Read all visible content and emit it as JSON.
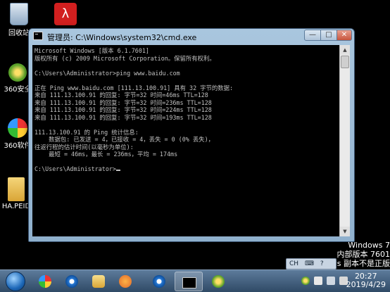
{
  "desktop": {
    "icons": [
      {
        "label": "回收站",
        "color": "#8fa9c4"
      },
      {
        "label": "",
        "color": "#d21f1f"
      },
      {
        "label": "360安全",
        "color": "#5aa12a"
      },
      {
        "label": "360软件",
        "color": "#36a84a"
      },
      {
        "label": "HA.PEID",
        "color": "#e0b040"
      }
    ]
  },
  "window": {
    "title": "管理员: C:\\Windows\\system32\\cmd.exe",
    "minimize": "—",
    "maximize": "□",
    "close": "✕"
  },
  "console": {
    "lines": [
      "Microsoft Windows [版本 6.1.7601]",
      "版权所有 (c) 2009 Microsoft Corporation。保留所有权利。",
      "",
      "C:\\Users\\Administrator>ping www.baidu.com",
      "",
      "正在 Ping www.baidu.com [111.13.100.91] 具有 32 字节的数据:",
      "来自 111.13.100.91 的回复: 字节=32 时间=46ms TTL=128",
      "来自 111.13.100.91 的回复: 字节=32 时间=236ms TTL=128",
      "来自 111.13.100.91 的回复: 字节=32 时间=224ms TTL=128",
      "来自 111.13.100.91 的回复: 字节=32 时间=193ms TTL=128",
      "",
      "111.13.100.91 的 Ping 统计信息:",
      "    数据包: 已发送 = 4，已接收 = 4，丢失 = 0 (0% 丢失)，",
      "往返行程的估计时间(以毫秒为单位):",
      "    最短 = 46ms，最长 = 236ms，平均 = 174ms",
      "",
      "C:\\Users\\Administrator>"
    ]
  },
  "watermark": {
    "line1": "Windows 7",
    "line2": "内部版本 7601",
    "line3": "ws 副本不是正版"
  },
  "langbar": {
    "lang": "CH",
    "icons": [
      "keyboard-icon",
      "help-icon"
    ]
  },
  "taskbar": {
    "clock_time": "20:27",
    "clock_date": "2019/4/29"
  },
  "colors": {
    "taskbar": "#3b5878",
    "console_bg": "#000000",
    "console_text": "#c0c0c0"
  }
}
